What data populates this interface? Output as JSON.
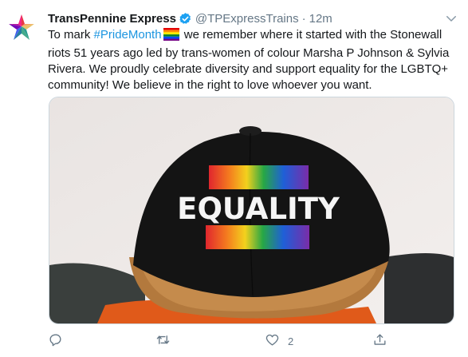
{
  "tweet": {
    "author_name": "TransPennine Express",
    "handle": "@TPExpressTrains",
    "separator": "·",
    "time": "12m",
    "text_before_hashtag": "To mark ",
    "hashtag": "#PrideMonth",
    "text_after_hashtag": " we remember where it started with the Stonewall riots 51 years ago led by trans-women of colour Marsha P Johnson & Sylvia Rivera. We proudly celebrate diversity and support equality for the LGBTQ+ community! We believe in the right to love whoever you want.",
    "image_text": "EQUALITY",
    "reply_count": "",
    "retweet_count": "",
    "like_count": "2",
    "share_count": ""
  },
  "icons": {
    "avatar": "rainbow-star-logo",
    "verified": "verified-badge-icon",
    "menu": "chevron-down-icon",
    "reply": "reply-icon",
    "retweet": "retweet-icon",
    "like": "heart-icon",
    "share": "share-icon"
  },
  "colors": {
    "accent": "#1b95e0",
    "text": "#14171a",
    "muted": "#657786",
    "border": "#ccd6dd"
  }
}
